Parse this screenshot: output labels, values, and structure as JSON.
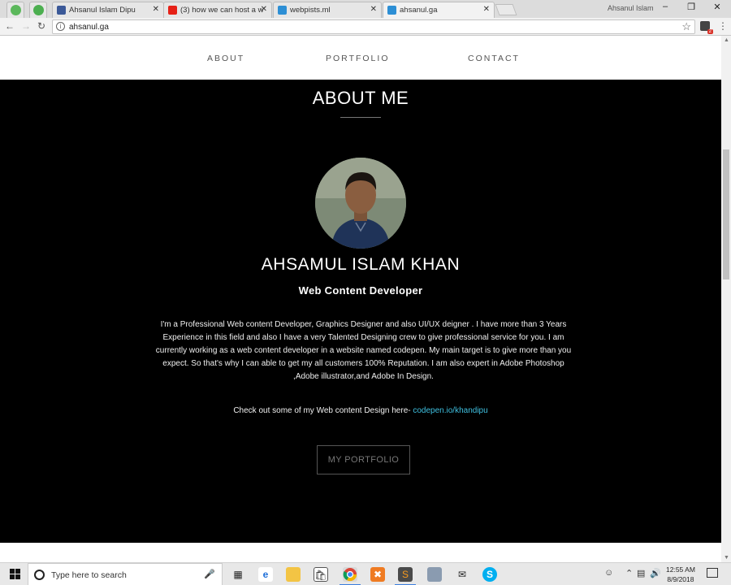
{
  "browser": {
    "tabs": [
      {
        "label": "Ahsanul Islam Dipu",
        "favicon_color": "#3b5998",
        "active": false
      },
      {
        "label": "(3) how we can host a w",
        "favicon_color": "#e62117",
        "active": false
      },
      {
        "label": "webpists.ml",
        "favicon_color": "#2d8fd5",
        "active": false
      },
      {
        "label": "ahsanul.ga",
        "favicon_color": "#2d8fd5",
        "active": true
      }
    ],
    "pinned_colors": [
      "#5cb85c",
      "#4caf50"
    ],
    "window_user": "Ahsanul Islam",
    "close_glyph": "✕",
    "address": "ahsanul.ga",
    "extension_badge": "2"
  },
  "site": {
    "nav": {
      "about": "ABOUT",
      "portfolio": "PORTFOLIO",
      "contact": "CONTACT"
    },
    "section_title": "ABOUT ME",
    "name": "AHSAMUL ISLAM KHAN",
    "role": "Web Content Developer",
    "bio": "I'm a Professional Web content Developer, Graphics Designer and also UI/UX deigner . I have more than 3 Years Experience in this field and also I have a very Talented Designing crew to give professional service for you. I am currently working as a web content developer in a website named codepen. My main target is to give more than you expect. So that's why I can able to get my all customers 100% Reputation. I am also expert in Adobe Photoshop ,Adobe illustrator,and Adobe In Design.",
    "checkout_text": "Check out some of my Web content Design here- ",
    "checkout_link": "codepen.io/khandipu",
    "portfolio_button": "MY PORTFOLIO",
    "accent_color": "#3fc0e0"
  },
  "taskbar": {
    "search_placeholder": "Type here to search",
    "time": "12:55 AM",
    "date": "8/9/2018"
  }
}
